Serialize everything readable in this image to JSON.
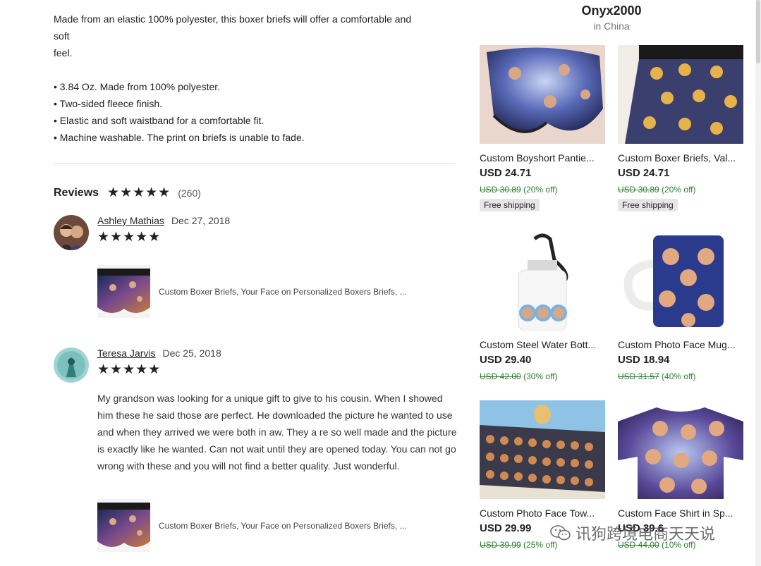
{
  "description": {
    "lines": [
      "Made from an elastic 100% polyester, this boxer briefs will offer a comfortable and",
      "soft",
      "feel.",
      "",
      "• 3.84 Oz. Made from 100% polyester.",
      "• Two-sided fleece finish.",
      "• Elastic and soft waistband for a comfortable fit.",
      "• Machine washable. The print on briefs is unable to fade."
    ]
  },
  "reviews": {
    "title": "Reviews",
    "rating_stars": "★★★★★",
    "count": "(260)",
    "items": [
      {
        "reviewer": "Ashley Mathias",
        "date": "Dec 27, 2018",
        "stars": "★★★★★",
        "text": "",
        "product_title": "Custom Boxer Briefs, Your Face on Personalized Boxers Briefs, ..."
      },
      {
        "reviewer": "Teresa Jarvis",
        "date": "Dec 25, 2018",
        "stars": "★★★★★",
        "text": "My grandson was looking for a unique gift to give to his cousin. When I showed him these he said those are perfect. He downloaded the picture he wanted to use and when they arrived we were both in aw. They a re so well made and the picture is exactly like he wanted. Can not wait until they are opened today. You can not go wrong with these and you will not find a better quality. Just wonderful.",
        "product_title": "Custom Boxer Briefs, Your Face on Personalized Boxers Briefs, ..."
      }
    ]
  },
  "shop": {
    "name": "Onyx2000",
    "location": "in China"
  },
  "products": [
    {
      "title": "Custom Boyshort Pantie...",
      "price": "USD 24.71",
      "original": "USD 30.89",
      "discount": "(20% off)",
      "badge": "Free shipping"
    },
    {
      "title": "Custom Boxer Briefs, Val...",
      "price": "USD 24.71",
      "original": "USD 30.89",
      "discount": "(20% off)",
      "badge": "Free shipping"
    },
    {
      "title": "Custom Steel Water Bott...",
      "price": "USD 29.40",
      "original": "USD 42.00",
      "discount": "(30% off)",
      "badge": ""
    },
    {
      "title": "Custom Photo Face Mug...",
      "price": "USD 18.94",
      "original": "USD 31.57",
      "discount": "(40% off)",
      "badge": ""
    },
    {
      "title": "Custom Photo Face Tow...",
      "price": "USD 29.99",
      "original": "USD 39.99",
      "discount": "(25% off)",
      "badge": ""
    },
    {
      "title": "Custom Face Shirt in Sp...",
      "price": "USD 39.6",
      "original": "USD 44.00",
      "discount": "(10% off)",
      "badge": ""
    }
  ],
  "watermark": {
    "text": "讯狗跨境电商天天说",
    "icon": "wechat-icon"
  },
  "colors": {
    "discount": "#2e7d32",
    "badge_bg": "#e6e6e6"
  }
}
